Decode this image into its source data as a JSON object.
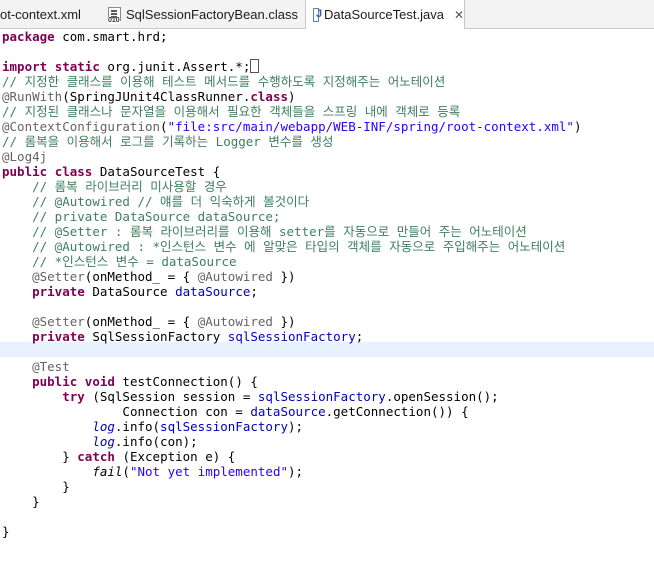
{
  "tabs": [
    {
      "label": "ot-context.xml",
      "icon": "xml-file-icon"
    },
    {
      "label": "SqlSessionFactoryBean.class",
      "icon": "class-file-icon",
      "badge": "010"
    },
    {
      "label": "DataSourceTest.java",
      "icon": "java-file-icon",
      "active": true
    }
  ],
  "colors": {
    "keyword": "#7f0055",
    "comment": "#3f7f5f",
    "annotation": "#646464",
    "string": "#2a00ff",
    "field": "#0000c0",
    "current_line": "#e8f2fe"
  },
  "code": {
    "l1_pkg_kw": "package",
    "l1_pkg_name": " com.smart.hrd;",
    "l3_import_kw": "import",
    "l3_static_kw": "static",
    "l3_import_name": " org.junit.Assert.*;",
    "l4_comment": "// 지정한 클래스를 이용해 테스트 메서드를 수행하도록 지정해주는 어노테이션",
    "l5_annot": "@RunWith",
    "l5_open": "(SpringJUnit4ClassRunner.",
    "l5_class_kw": "class",
    "l5_close": ")",
    "l6_comment": "// 지정된 클래스나 문자열을 이용해서 필요한 객체들을 스프링 내에 객체로 등록",
    "l7_annot": "@ContextConfiguration",
    "l7_open": "(",
    "l7_string": "\"file:src/main/webapp/WEB-INF/spring/root-context.xml\"",
    "l7_close": ")",
    "l8_comment": "// 롬복을 이용해서 로그를 기록하는 Logger 변수를 생성",
    "l9_annot": "@Log4j",
    "l10_public_kw": "public",
    "l10_class_kw": "class",
    "l10_name": " DataSourceTest {",
    "l11_comment": "// 롬복 라이브러리 미사용할 경우",
    "l12_comment": "// @Autowired // 얘를 더 익숙하게 볼것이다",
    "l13_comment": "// private DataSource dataSource;",
    "l14_comment": "// @Setter : 롬복 라이브러리를 이용해 setter를 자동으로 만들어 주는 어노테이션",
    "l15_comment": "// @Autowired : *인스턴스 변수 에 알맞은 타입의 객체를 자동으로 주입해주는 어노테이션",
    "l16_comment": "// *인스턴스 변수 = dataSource",
    "setter_annot": "@Setter",
    "setter_open": "(onMethod_ = { ",
    "autowired_annot": "@Autowired",
    "setter_close": " })",
    "private_kw": "private",
    "l18_type": " DataSource ",
    "l18_field": "dataSource",
    "semicolon": ";",
    "l21_type": " SqlSessionFactory ",
    "l21_field": "sqlSessionFactory",
    "l23_annot": "@Test",
    "l24_public_kw": "public",
    "l24_void_kw": "void",
    "l24_rest": " testConnection() {",
    "l25_try_kw": "try",
    "l25_a": " (SqlSession session = ",
    "l25_field": "sqlSessionFactory",
    "l25_b": ".openSession();",
    "l26_a": "Connection con = ",
    "l26_field": "dataSource",
    "l26_b": ".getConnection()) {",
    "log": "log",
    "l27_a": ".info(",
    "l27_field": "sqlSessionFactory",
    "l27_b": ");",
    "l28_rest": ".info(con);",
    "l29_a": "} ",
    "l29_catch_kw": "catch",
    "l29_b": " (Exception e) {",
    "l30_fail": "fail",
    "l30_open": "(",
    "l30_string": "\"Not yet implemented\"",
    "l30_close": ");",
    "l31_close": "}",
    "l32_close": "}",
    "l34_close": "}"
  }
}
